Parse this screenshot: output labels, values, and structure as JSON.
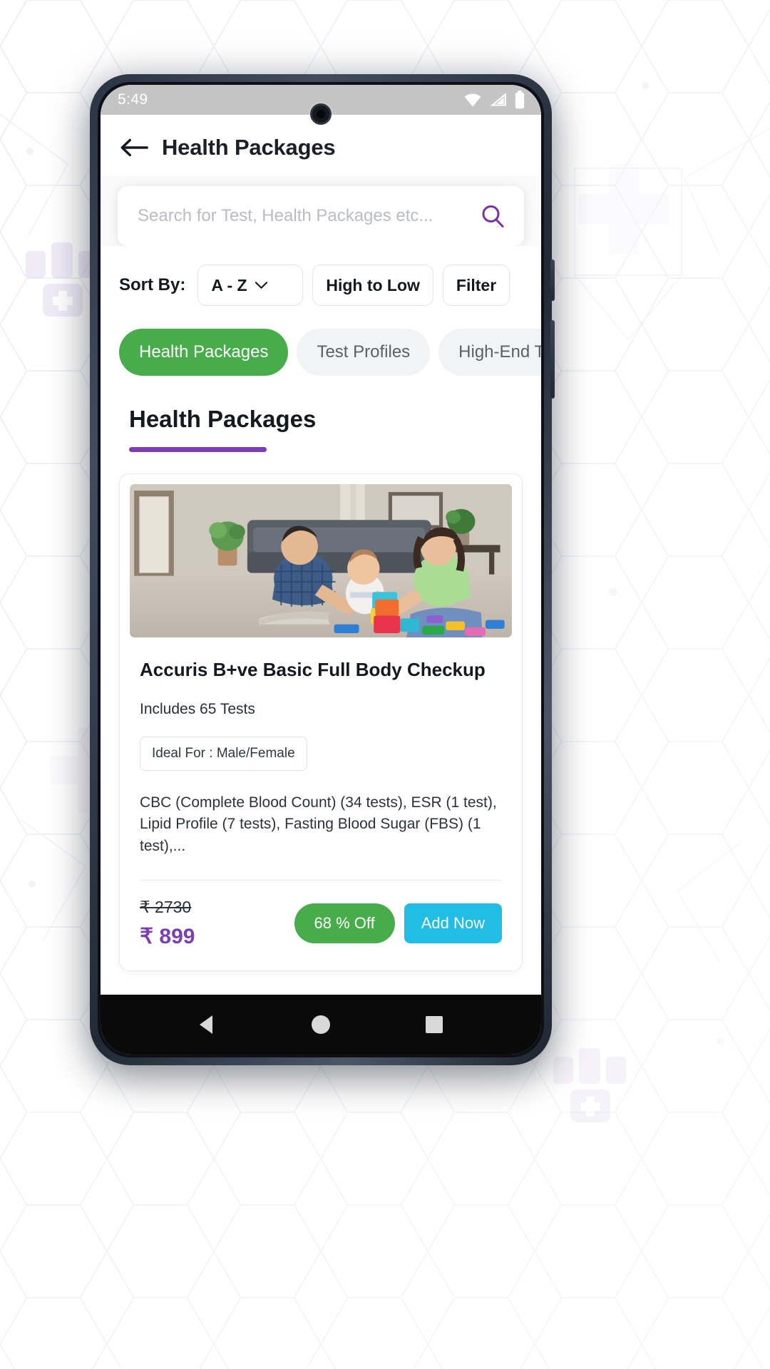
{
  "status_bar": {
    "time": "5:49",
    "icons": [
      "wifi-icon",
      "signal-icon",
      "battery-icon"
    ]
  },
  "app_bar": {
    "back_icon": "back-arrow-icon",
    "title": "Health Packages"
  },
  "search": {
    "placeholder": "Search for Test, Health Packages etc...",
    "value": "",
    "icon": "search-icon"
  },
  "sort": {
    "label": "Sort By:",
    "options": [
      {
        "label": "A - Z",
        "has_chevron": true
      },
      {
        "label": "High to Low",
        "has_chevron": false
      },
      {
        "label": "Filter",
        "has_chevron": false
      }
    ]
  },
  "tabs": [
    {
      "label": "Health Packages",
      "active": true
    },
    {
      "label": "Test Profiles",
      "active": false
    },
    {
      "label": "High-End Test",
      "active": false
    }
  ],
  "section": {
    "title": "Health Packages"
  },
  "package_card": {
    "image_alt": "family-playing-with-baby-photo",
    "title": "Accuris B+ve Basic Full Body Checkup",
    "includes": "Includes 65 Tests",
    "ideal_for": "Ideal For : Male/Female",
    "description": "CBC (Complete Blood Count) (34 tests), ESR (1 test), Lipid Profile (7 tests), Fasting Blood Sugar (FBS) (1 test),...",
    "price_original": "₹ 2730",
    "price_current": "₹ 899",
    "discount_label": "68 % Off",
    "add_label": "Add Now"
  },
  "nav_bar": {
    "back": "nav-back-icon",
    "home": "nav-home-icon",
    "recents": "nav-recents-icon"
  },
  "colors": {
    "green": "#47ad4a",
    "purple": "#7b3fb0",
    "cyan": "#22bde5",
    "underline": "#7a3fb5"
  }
}
